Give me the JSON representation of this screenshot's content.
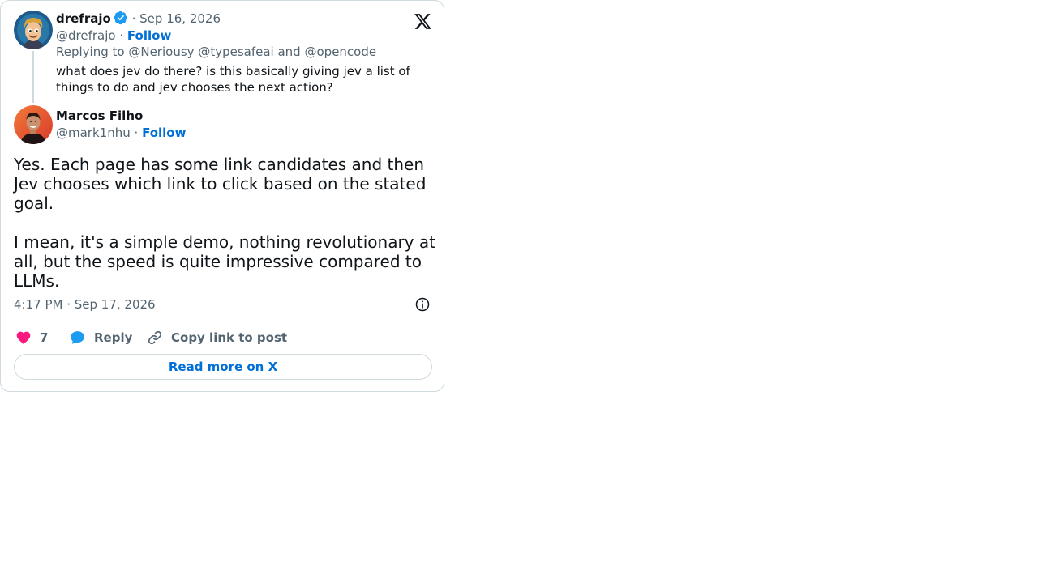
{
  "parent_post": {
    "display_name": "drefrajo",
    "verified": true,
    "date": "Sep 16, 2026",
    "date_sep": "·",
    "handle": "@drefrajo",
    "handle_sep": "·",
    "follow_label": "Follow",
    "replying_prefix": "Replying to",
    "replying_to": [
      "@Neriousy",
      "@typesafeai",
      "@opencode"
    ],
    "replying_and": "and",
    "text": "what does jev do there? is this basically giving jev a list of things to do and jev chooses the next action?"
  },
  "main_post": {
    "display_name": "Marcos Filho",
    "handle": "@mark1nhu",
    "handle_sep": "·",
    "follow_label": "Follow",
    "text": "Yes. Each page has some link candidates and then Jev chooses which link to click based on the stated goal.\n\nI mean, it's a simple demo, nothing revolutionary at all, but the speed is quite impressive compared to LLMs.",
    "timestamp": "4:17 PM · Sep 17, 2026"
  },
  "actions": {
    "like_count": "7",
    "reply_label": "Reply",
    "copy_link_label": "Copy link to post"
  },
  "read_more_label": "Read more on X",
  "icons": {
    "brand": "x-logo-icon",
    "verified": "verified-badge-icon",
    "info": "info-icon",
    "like": "heart-icon",
    "reply": "speech-bubble-icon",
    "copy": "link-icon"
  },
  "colors": {
    "follow_blue": "#006fd6",
    "verified_blue": "#1d9bf0",
    "like_pink": "#f91880",
    "muted": "#536471",
    "border": "#cfd9de"
  }
}
